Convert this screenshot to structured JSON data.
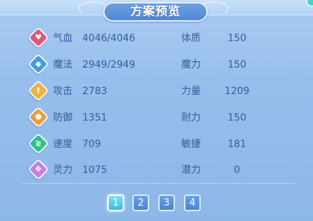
{
  "title": "方案预览",
  "stats": [
    {
      "icon": "heart-icon",
      "glyph": "♥",
      "color": "#e0567a",
      "label": "气血",
      "value": "4046/4046",
      "right_label": "体质",
      "right_value": "150"
    },
    {
      "icon": "mana-diamond-icon",
      "glyph": "◆",
      "color": "#3f9ee8",
      "label": "魔法",
      "value": "2949/2949",
      "right_label": "魔力",
      "right_value": "150"
    },
    {
      "icon": "sword-icon",
      "glyph": "†",
      "color": "#f0b23a",
      "label": "攻击",
      "value": "2783",
      "right_label": "力量",
      "right_value": "1209"
    },
    {
      "icon": "shield-icon",
      "glyph": "⬟",
      "color": "#f09a3c",
      "label": "防御",
      "value": "1351",
      "right_label": "耐力",
      "right_value": "150"
    },
    {
      "icon": "speed-icon",
      "glyph": "≷",
      "color": "#2fc18a",
      "label": "速度",
      "value": "709",
      "right_label": "敏捷",
      "right_value": "181"
    },
    {
      "icon": "spirit-icon",
      "glyph": "✥",
      "color": "#c77fe0",
      "label": "灵力",
      "value": "1075",
      "right_label": "潜力",
      "right_value": "0"
    }
  ],
  "pages": [
    "1",
    "2",
    "3",
    "4"
  ],
  "active_page": "1"
}
